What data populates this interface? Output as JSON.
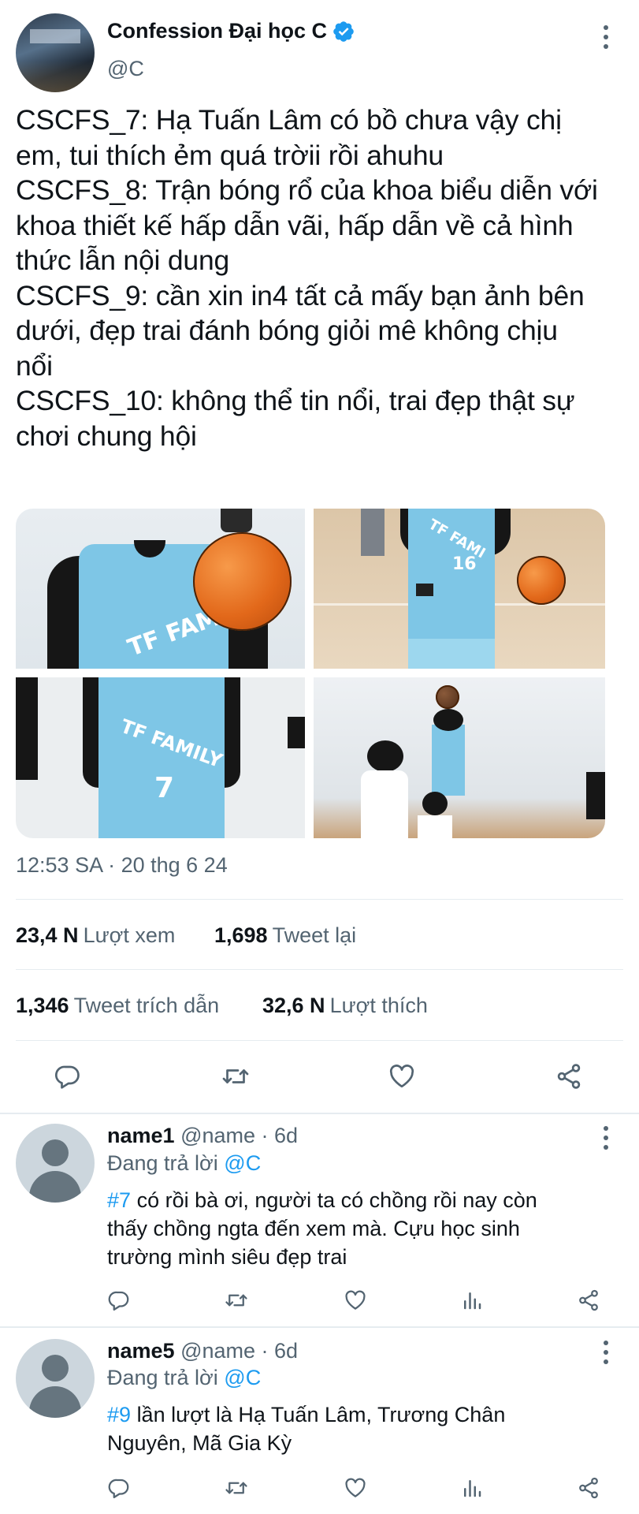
{
  "tweet": {
    "display_name": "Confession Đại học C",
    "handle": "@C",
    "text_lines": [
      "CSCFS_7: Hạ Tuấn Lâm có bồ chưa vậy chị",
      "em, tui thích ẻm quá trờii rồi ahuhu",
      "CSCFS_8: Trận bóng rổ của khoa biểu diễn với",
      "khoa thiết kế hấp dẫn vãi, hấp dẫn về cả hình",
      "thức lẫn nội dung",
      "CSCFS_9: cần xin in4 tất cả mấy bạn ảnh bên",
      "dưới, đẹp trai đánh bóng giỏi mê không chịu",
      "nổi",
      "CSCFS_10: không thể tin nổi, trai đẹp thật sự",
      "chơi chung hội"
    ],
    "media": [
      {
        "jersey_text": "TF FAM"
      },
      {
        "jersey_text": "TF FAMI",
        "number": "16"
      },
      {
        "jersey_text": "TF FAMILY",
        "number": "7"
      },
      {
        "jersey_text": ""
      }
    ],
    "timestamp": "12:53 SA · 20 thg 6 24",
    "stats": {
      "views_value": "23,4 N",
      "views_label": "Lượt xem",
      "retweets_value": "1,698",
      "retweets_label": "Tweet lại",
      "quotes_value": "1,346",
      "quotes_label": "Tweet trích dẫn",
      "likes_value": "32,6 N",
      "likes_label": "Lượt thích"
    }
  },
  "replies": [
    {
      "name": "name1",
      "meta": "@name · 6d",
      "replying_prefix": "Đang trả lời",
      "replying_to": "@C",
      "hashtag": "#7",
      "line1": "có rồi bà ơi, người ta có chồng rồi nay còn",
      "line2": "thấy chồng ngta đến xem mà. Cựu học sinh",
      "line3": "trường mình siêu đẹp trai"
    },
    {
      "name": "name5",
      "meta": "@name · 6d",
      "replying_prefix": "Đang trả lời",
      "replying_to": "@C",
      "hashtag": "#9",
      "line1": "lần lượt là Hạ Tuấn Lâm, Trương Chân",
      "line2": "Nguyên, Mã Gia Kỳ"
    }
  ],
  "icons": [
    "verified-badge-icon",
    "more-options-icon",
    "reply-icon",
    "retweet-icon",
    "like-icon",
    "share-icon",
    "analytics-icon",
    "default-avatar-icon"
  ],
  "colors": {
    "accent": "#1d9bf0",
    "muted": "#536471",
    "text": "#0f1419",
    "divider": "#e6ecf0",
    "jersey": "#7ec6e6"
  }
}
